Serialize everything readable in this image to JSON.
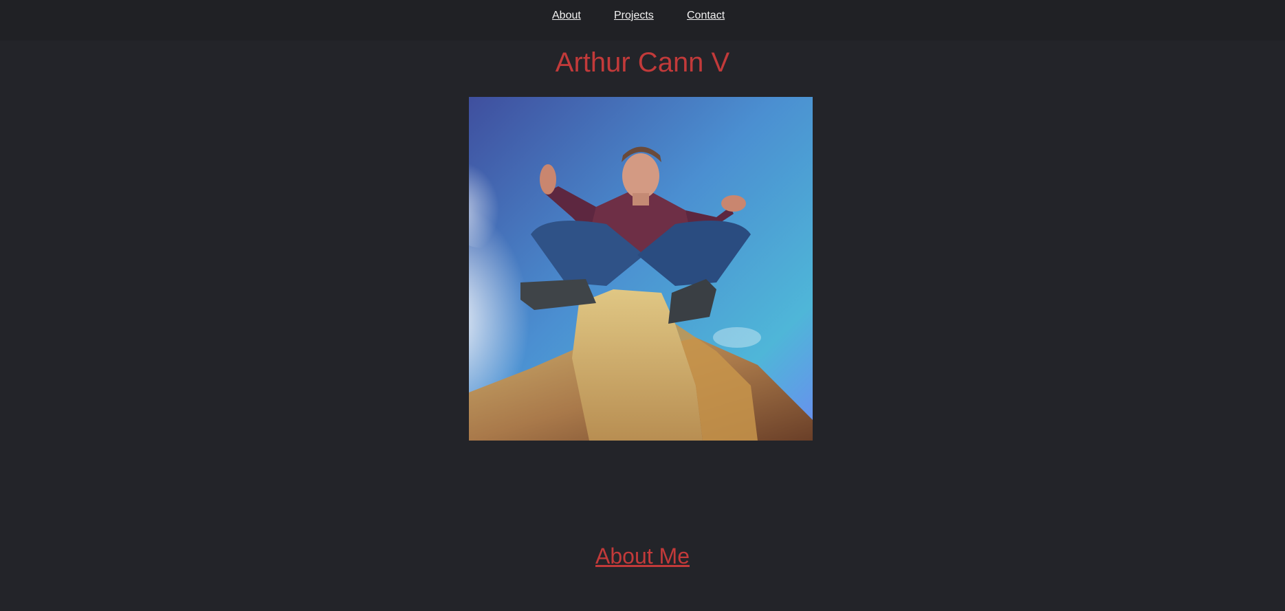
{
  "nav": {
    "items": [
      {
        "label": "About"
      },
      {
        "label": "Projects"
      },
      {
        "label": "Contact"
      }
    ]
  },
  "header": {
    "title": "Arthur Cann V"
  },
  "profile_photo": {
    "description_icon": "meditating-person-on-rock-photo"
  },
  "sections": {
    "about_heading": "About Me"
  },
  "colors": {
    "background": "#232429",
    "nav_background": "#202125",
    "accent": "#c23a3a",
    "nav_text": "#f2f2f2"
  }
}
